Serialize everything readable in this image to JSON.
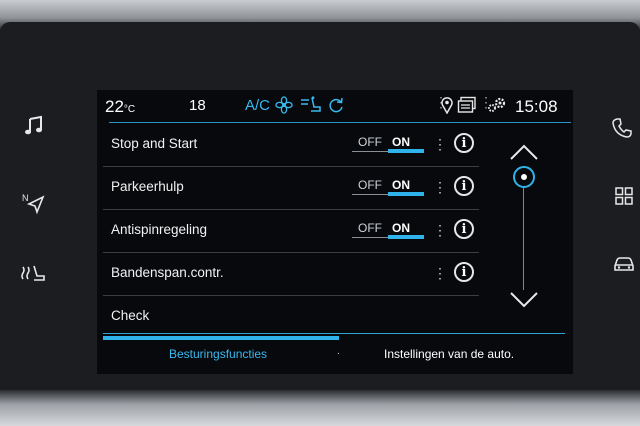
{
  "status": {
    "temp_left": "22",
    "temp_unit": "°C",
    "fan_level": "18",
    "ac_label": "A/C",
    "clock": "15:08",
    "icons": [
      "fan-icon",
      "seat-airflow-icon",
      "recirculation-icon",
      "location-pin-icon",
      "navigation-card-icon",
      "settings-gear-icon"
    ]
  },
  "rows": [
    {
      "label": "Stop and Start",
      "off_label": "OFF",
      "on_label": "ON",
      "state": "ON"
    },
    {
      "label": "Parkeerhulp",
      "off_label": "OFF",
      "on_label": "ON",
      "state": "ON"
    },
    {
      "label": "Antispinregeling",
      "off_label": "OFF",
      "on_label": "ON",
      "state": "ON"
    },
    {
      "label": "Bandenspan.contr."
    },
    {
      "label": "Check"
    }
  ],
  "info_glyph": "i",
  "tabs": [
    {
      "label": "Besturingsfuncties",
      "active": true
    },
    {
      "label": "Instellingen van de auto.",
      "active": false
    }
  ],
  "colors": {
    "accent": "#2fb3ea",
    "ac_color": "#38b9f0",
    "background": "#07090c"
  },
  "side_left_icons": [
    "music-icon",
    "navigation-icon",
    "climate-seat-icon"
  ],
  "side_right_icons": [
    "phone-icon",
    "apps-grid-icon",
    "car-icon"
  ]
}
